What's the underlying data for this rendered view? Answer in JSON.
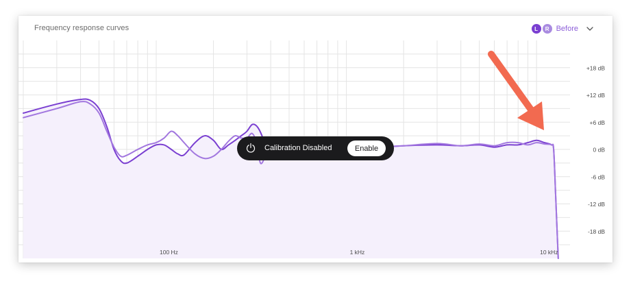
{
  "header": {
    "title": "Frequency response curves",
    "channel_left": "L",
    "channel_right": "R",
    "state_label": "Before",
    "dropdown_icon": "chevron-down-icon"
  },
  "colors": {
    "left_curve": "#7a3fd1",
    "right_curve": "#a277df",
    "fill": "#f5f0fc",
    "grid": "#e4e4e4",
    "accent": "#8d5fd9",
    "toast_bg": "#1b1b1d",
    "arrow": "#f26a50"
  },
  "toast": {
    "icon": "power-icon",
    "message": "Calibration Disabled",
    "button_label": "Enable"
  },
  "annotation": {
    "icon": "arrow-icon",
    "color": "#f26a50"
  },
  "chart_data": {
    "type": "line",
    "title": "Frequency response curves",
    "x_scale": "log",
    "xlim": [
      20,
      15000
    ],
    "ylim": [
      -24,
      24
    ],
    "y_ticks": [
      {
        "value": 18,
        "label": "+18 dB"
      },
      {
        "value": 12,
        "label": "+12 dB"
      },
      {
        "value": 6,
        "label": "+6 dB"
      },
      {
        "value": 0,
        "label": "0 dB"
      },
      {
        "value": -6,
        "label": "-6 dB"
      },
      {
        "value": -12,
        "label": "-12 dB"
      },
      {
        "value": -18,
        "label": "-18 dB"
      }
    ],
    "x_ticks": [
      {
        "value": 100,
        "label": "100 Hz"
      },
      {
        "value": 1000,
        "label": "1 kHz"
      },
      {
        "value": 10000,
        "label": "10 kHz"
      }
    ],
    "grid": true,
    "series": [
      {
        "key": "L",
        "points": [
          [
            20,
            8
          ],
          [
            30,
            10
          ],
          [
            40,
            11
          ],
          [
            45,
            10.8
          ],
          [
            50,
            9
          ],
          [
            55,
            5
          ],
          [
            60,
            0
          ],
          [
            65,
            -2.5
          ],
          [
            70,
            -3
          ],
          [
            80,
            -1.5
          ],
          [
            90,
            0
          ],
          [
            100,
            1
          ],
          [
            110,
            1
          ],
          [
            120,
            0
          ],
          [
            130,
            -1
          ],
          [
            140,
            -1.2
          ],
          [
            160,
            1.5
          ],
          [
            180,
            3
          ],
          [
            200,
            2
          ],
          [
            220,
            0
          ],
          [
            240,
            1
          ],
          [
            260,
            2
          ],
          [
            280,
            3
          ],
          [
            300,
            4
          ],
          [
            320,
            5.5
          ],
          [
            340,
            5
          ],
          [
            360,
            3
          ],
          [
            380,
            0
          ],
          [
            400,
            -1
          ],
          [
            450,
            0
          ],
          [
            500,
            0.5
          ],
          [
            600,
            0.8
          ],
          [
            800,
            0.5
          ],
          [
            1000,
            0.3
          ],
          [
            1500,
            0.5
          ],
          [
            2000,
            0.8
          ],
          [
            3000,
            1
          ],
          [
            4000,
            0.8
          ],
          [
            5000,
            1
          ],
          [
            6000,
            0.5
          ],
          [
            7000,
            1
          ],
          [
            8000,
            1
          ],
          [
            9000,
            1.5
          ],
          [
            10000,
            2
          ],
          [
            11000,
            1.5
          ],
          [
            12000,
            1
          ],
          [
            12300,
            0
          ],
          [
            12600,
            -10
          ],
          [
            13000,
            -24
          ]
        ]
      },
      {
        "key": "R",
        "points": [
          [
            20,
            7
          ],
          [
            30,
            9
          ],
          [
            40,
            10.5
          ],
          [
            45,
            10
          ],
          [
            50,
            8
          ],
          [
            55,
            4
          ],
          [
            60,
            0.5
          ],
          [
            65,
            -1.5
          ],
          [
            70,
            -1.3
          ],
          [
            80,
            0
          ],
          [
            90,
            1
          ],
          [
            100,
            1.5
          ],
          [
            110,
            2.5
          ],
          [
            120,
            4
          ],
          [
            130,
            3
          ],
          [
            140,
            1.5
          ],
          [
            160,
            -1
          ],
          [
            180,
            -2
          ],
          [
            200,
            -1.5
          ],
          [
            220,
            0
          ],
          [
            240,
            1.8
          ],
          [
            260,
            3
          ],
          [
            280,
            2.5
          ],
          [
            300,
            2.5
          ],
          [
            320,
            3.5
          ],
          [
            340,
            1
          ],
          [
            350,
            -2.5
          ],
          [
            360,
            -3
          ],
          [
            380,
            -1
          ],
          [
            400,
            0
          ],
          [
            450,
            0.5
          ],
          [
            500,
            0.8
          ],
          [
            600,
            0.7
          ],
          [
            800,
            0.5
          ],
          [
            1000,
            0.5
          ],
          [
            1500,
            0.6
          ],
          [
            2000,
            0.8
          ],
          [
            3000,
            1.3
          ],
          [
            4000,
            0.8
          ],
          [
            5000,
            1.2
          ],
          [
            6000,
            0.8
          ],
          [
            7000,
            1.5
          ],
          [
            8000,
            1.5
          ],
          [
            9000,
            1
          ],
          [
            10000,
            1.5
          ],
          [
            11000,
            1.2
          ],
          [
            12000,
            1
          ],
          [
            12300,
            0
          ],
          [
            12600,
            -10
          ],
          [
            13000,
            -24
          ]
        ]
      }
    ]
  }
}
